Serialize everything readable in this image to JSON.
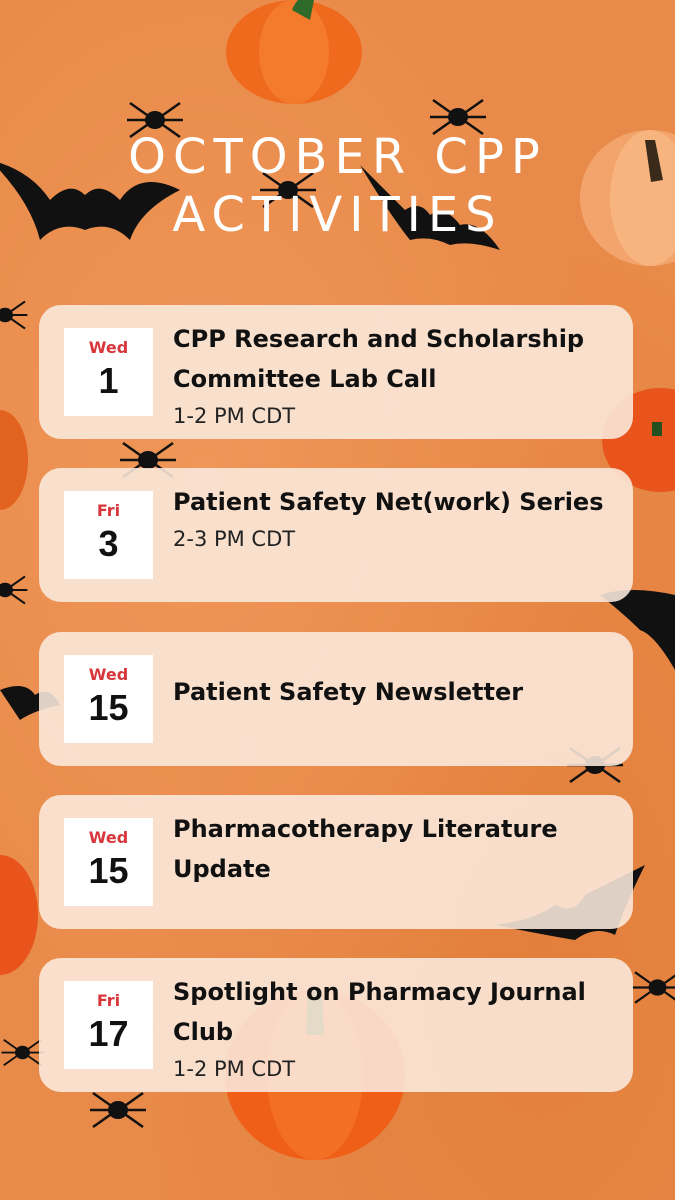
{
  "title": {
    "line1": "October CPP",
    "line2": "Activities"
  },
  "events": [
    {
      "dow": "Wed",
      "day": "1",
      "title": "CPP Research and Scholarship Committee Lab Call",
      "time": "1-2 PM CDT"
    },
    {
      "dow": "Fri",
      "day": "3",
      "title": "Patient Safety Net(work) Series",
      "time": "2-3 PM CDT"
    },
    {
      "dow": "Wed",
      "day": "15",
      "title": "Patient Safety Newsletter",
      "time": ""
    },
    {
      "dow": "Wed",
      "day": "15",
      "title": "Pharmacotherapy Literature Update",
      "time": ""
    },
    {
      "dow": "Fri",
      "day": "17",
      "title": "Spotlight on Pharmacy Journal Club",
      "time": "1-2 PM CDT"
    }
  ],
  "colors": {
    "background": "#e88a49",
    "card": "#fbebde",
    "day_of_week": "#d8363a",
    "pumpkin": "#f06a1e"
  },
  "decorations": [
    "pumpkin-icon",
    "spider-icon",
    "bat-icon"
  ]
}
